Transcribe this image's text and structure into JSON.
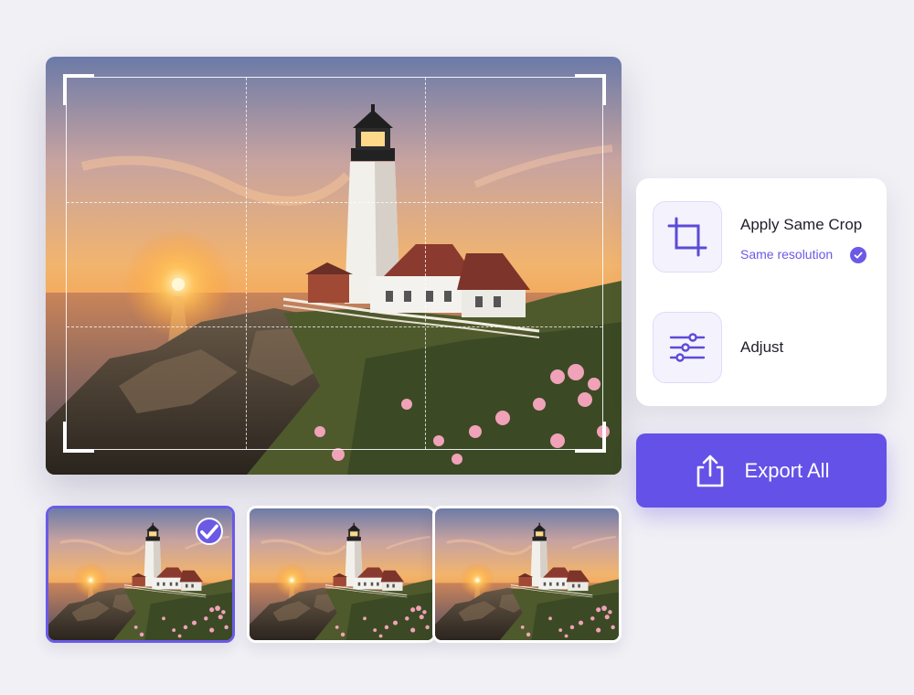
{
  "editor": {
    "image_alt": "Lighthouse at sunset on rocky coast"
  },
  "thumbnails": [
    {
      "selected": true
    },
    {
      "selected": false
    },
    {
      "selected": false
    }
  ],
  "panel": {
    "apply_crop_label": "Apply Same Crop",
    "same_resolution_label": "Same resolution",
    "adjust_label": "Adjust"
  },
  "export": {
    "label": "Export All"
  },
  "colors": {
    "accent": "#6451e7",
    "background": "#f1f0f5",
    "panel": "#ffffff"
  },
  "icons": [
    "crop-icon",
    "check-icon",
    "sliders-icon",
    "upload-icon"
  ]
}
